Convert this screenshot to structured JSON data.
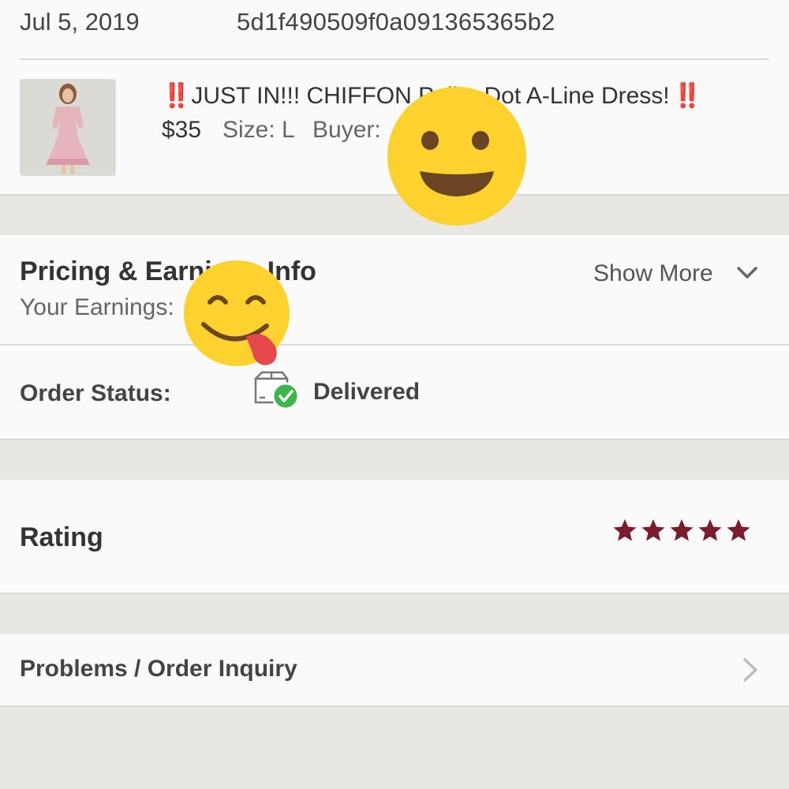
{
  "order": {
    "date": "Jul 5, 2019",
    "id": "5d1f490509f0a091365365b2"
  },
  "item": {
    "title_prefix_emoji": "‼️",
    "title": "JUST IN!!! CHIFFON Polka Dot A-Line Dress!",
    "title_suffix_emoji": "‼️",
    "price": "$35",
    "size": "Size: L",
    "buyer": "Buyer:"
  },
  "pricing": {
    "title": "Pricing & Earnings Info",
    "earnings_label": "Your Earnings:",
    "show_more": "Show More"
  },
  "status": {
    "label": "Order Status:",
    "value": "Delivered"
  },
  "rating": {
    "label": "Rating",
    "stars": 5,
    "star_color": "#7b1c2c"
  },
  "problems": {
    "label": "Problems / Order Inquiry"
  },
  "stickers": [
    "smiling-face-emoji",
    "face-savoring-food-emoji"
  ]
}
